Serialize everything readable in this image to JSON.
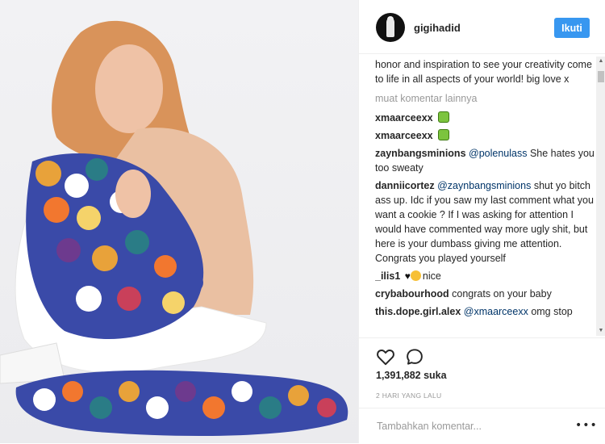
{
  "post": {
    "username": "gigihadid",
    "follow_label": "Ikuti",
    "caption_tail": "honor and inspiration to see your creativity come to life in all aspects of your world! big love x",
    "load_more_label": "muat komentar lainnya",
    "likes": "1,391,882 suka",
    "timestamp": "2 HARI YANG LALU",
    "add_comment_placeholder": "Tambahkan komentar...",
    "options_label": "•••"
  },
  "comments": [
    {
      "user": "xmaarceexx",
      "before": "",
      "mention": "",
      "text": "",
      "emoji": "green-square"
    },
    {
      "user": "xmaarceexx",
      "before": "",
      "mention": "",
      "text": "",
      "emoji": "green-square"
    },
    {
      "user": "zaynbangsminions",
      "before": "",
      "mention": "@polenulass",
      "text": " She hates you too sweaty",
      "emoji": ""
    },
    {
      "user": "danniicortez",
      "before": "",
      "mention": "@zaynbangsminions",
      "text": " shut yo bitch ass up. Idc if you saw my last comment what you want a cookie ? If I was asking for attention I would have commented way more ugly shit, but here is your dumbass giving me attention. Congrats you played yourself",
      "emoji": ""
    },
    {
      "user": "_ilis1",
      "before": "",
      "mention": "",
      "text": "nice",
      "emoji": "heart-face"
    },
    {
      "user": "crybabourhood",
      "before": "",
      "mention": "",
      "text": " congrats on your baby",
      "emoji": ""
    },
    {
      "user": "this.dope.girl.alex",
      "before": "",
      "mention": "@xmaarceexx",
      "text": " omg stop",
      "emoji": ""
    }
  ],
  "icons": {
    "like": "heart-outline-icon",
    "comment": "speech-bubble-icon",
    "avatar": "profile-photo",
    "scroll_up": "▲",
    "scroll_down": "▼"
  },
  "colors": {
    "follow_button": "#3897f0",
    "mention": "#003569",
    "muted": "#999999"
  }
}
